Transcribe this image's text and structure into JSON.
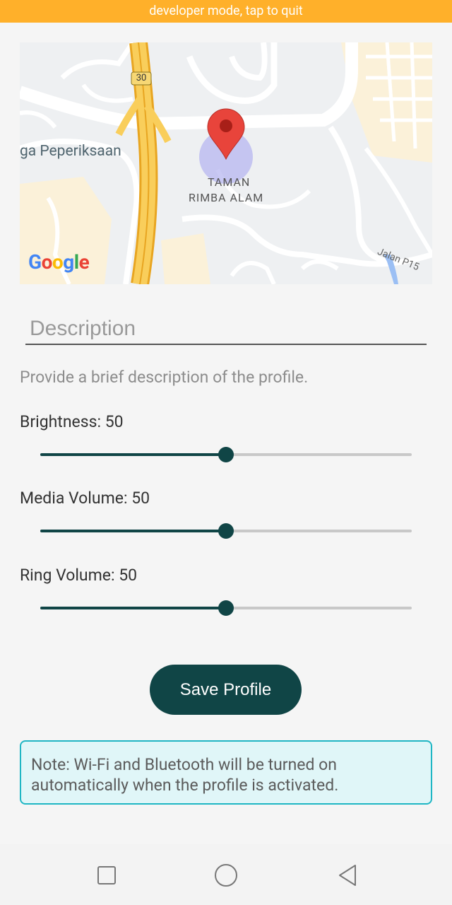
{
  "status_banner": {
    "text": "developer mode, tap to quit"
  },
  "map": {
    "road_shield": "30",
    "place_label_left": "ga Peperiksaan",
    "area_label_line1": "TAMAN",
    "area_label_line2": "RIMBA ALAM",
    "street_label": "Jalan P15",
    "attribution": "Google",
    "marker_icon": "map-pin-icon",
    "colors": {
      "pin": "#e8443b",
      "highway": "#f7c045",
      "accuracy_circle": "#b7b7f0"
    }
  },
  "description": {
    "placeholder": "Description",
    "value": ""
  },
  "helper_text": "Provide a brief description of the profile.",
  "sliders": [
    {
      "label": "Brightness: 50",
      "value": 50,
      "max": 100
    },
    {
      "label": "Media Volume: 50",
      "value": 50,
      "max": 100
    },
    {
      "label": "Ring Volume: 50",
      "value": 50,
      "max": 100
    }
  ],
  "save_button": {
    "label": "Save Profile"
  },
  "note": {
    "text": "Note: Wi-Fi and Bluetooth will be turned on automatically when the profile is activated."
  },
  "nav_bar": {
    "icons": [
      "square-recents-icon",
      "circle-home-icon",
      "triangle-back-icon"
    ]
  },
  "colors": {
    "accent": "#104546",
    "banner": "#ffb02a",
    "note_border": "#1fb6c4",
    "note_bg": "#e0f6f8"
  }
}
